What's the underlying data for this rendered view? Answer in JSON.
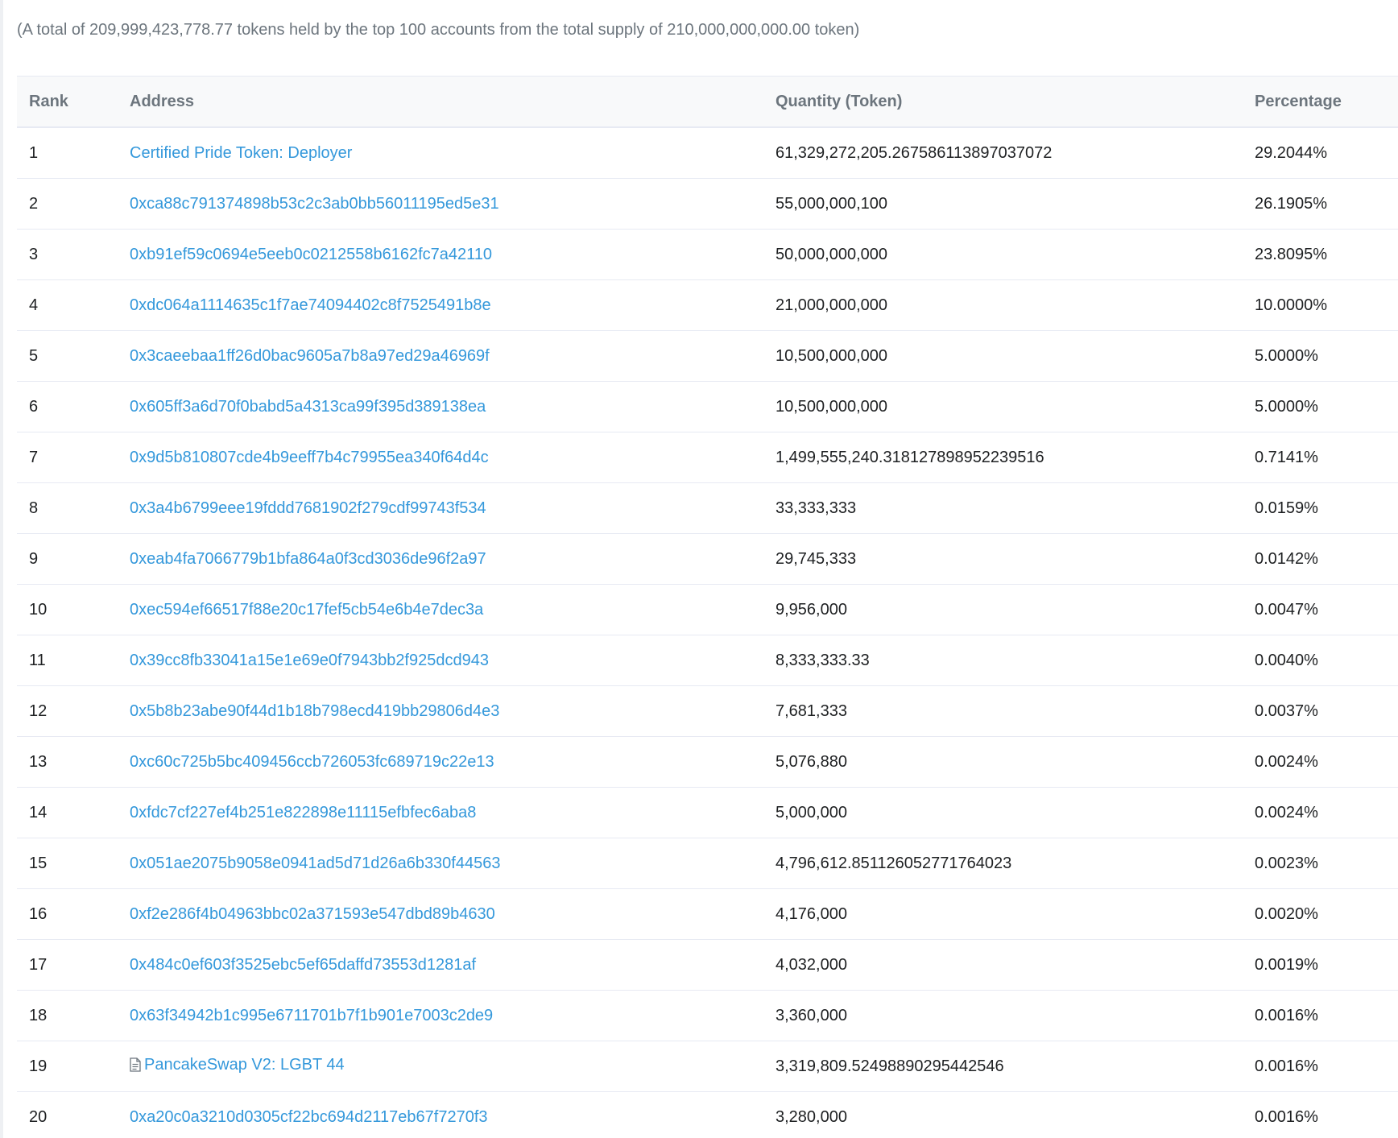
{
  "summary": "(A total of 209,999,423,778.77 tokens held by the top 100 accounts from the total supply of 210,000,000,000.00 token)",
  "table": {
    "headers": {
      "rank": "Rank",
      "address": "Address",
      "quantity": "Quantity (Token)",
      "percentage": "Percentage"
    },
    "rows": [
      {
        "rank": "1",
        "address": "Certified Pride Token: Deployer",
        "quantity": "61,329,272,205.267586113897037072",
        "percentage": "29.2044%",
        "icon": ""
      },
      {
        "rank": "2",
        "address": "0xca88c791374898b53c2c3ab0bb56011195ed5e31",
        "quantity": "55,000,000,100",
        "percentage": "26.1905%",
        "icon": ""
      },
      {
        "rank": "3",
        "address": "0xb91ef59c0694e5eeb0c0212558b6162fc7a42110",
        "quantity": "50,000,000,000",
        "percentage": "23.8095%",
        "icon": ""
      },
      {
        "rank": "4",
        "address": "0xdc064a1114635c1f7ae74094402c8f7525491b8e",
        "quantity": "21,000,000,000",
        "percentage": "10.0000%",
        "icon": ""
      },
      {
        "rank": "5",
        "address": "0x3caeebaa1ff26d0bac9605a7b8a97ed29a46969f",
        "quantity": "10,500,000,000",
        "percentage": "5.0000%",
        "icon": ""
      },
      {
        "rank": "6",
        "address": "0x605ff3a6d70f0babd5a4313ca99f395d389138ea",
        "quantity": "10,500,000,000",
        "percentage": "5.0000%",
        "icon": ""
      },
      {
        "rank": "7",
        "address": "0x9d5b810807cde4b9eeff7b4c79955ea340f64d4c",
        "quantity": "1,499,555,240.318127898952239516",
        "percentage": "0.7141%",
        "icon": ""
      },
      {
        "rank": "8",
        "address": "0x3a4b6799eee19fddd7681902f279cdf99743f534",
        "quantity": "33,333,333",
        "percentage": "0.0159%",
        "icon": ""
      },
      {
        "rank": "9",
        "address": "0xeab4fa7066779b1bfa864a0f3cd3036de96f2a97",
        "quantity": "29,745,333",
        "percentage": "0.0142%",
        "icon": ""
      },
      {
        "rank": "10",
        "address": "0xec594ef66517f88e20c17fef5cb54e6b4e7dec3a",
        "quantity": "9,956,000",
        "percentage": "0.0047%",
        "icon": ""
      },
      {
        "rank": "11",
        "address": "0x39cc8fb33041a15e1e69e0f7943bb2f925dcd943",
        "quantity": "8,333,333.33",
        "percentage": "0.0040%",
        "icon": ""
      },
      {
        "rank": "12",
        "address": "0x5b8b23abe90f44d1b18b798ecd419bb29806d4e3",
        "quantity": "7,681,333",
        "percentage": "0.0037%",
        "icon": ""
      },
      {
        "rank": "13",
        "address": "0xc60c725b5bc409456ccb726053fc689719c22e13",
        "quantity": "5,076,880",
        "percentage": "0.0024%",
        "icon": ""
      },
      {
        "rank": "14",
        "address": "0xfdc7cf227ef4b251e822898e11115efbfec6aba8",
        "quantity": "5,000,000",
        "percentage": "0.0024%",
        "icon": ""
      },
      {
        "rank": "15",
        "address": "0x051ae2075b9058e0941ad5d71d26a6b330f44563",
        "quantity": "4,796,612.851126052771764023",
        "percentage": "0.0023%",
        "icon": ""
      },
      {
        "rank": "16",
        "address": "0xf2e286f4b04963bbc02a371593e547dbd89b4630",
        "quantity": "4,176,000",
        "percentage": "0.0020%",
        "icon": ""
      },
      {
        "rank": "17",
        "address": "0x484c0ef603f3525ebc5ef65daffd73553d1281af",
        "quantity": "4,032,000",
        "percentage": "0.0019%",
        "icon": ""
      },
      {
        "rank": "18",
        "address": "0x63f34942b1c995e6711701b7f1b901e7003c2de9",
        "quantity": "3,360,000",
        "percentage": "0.0016%",
        "icon": ""
      },
      {
        "rank": "19",
        "address": "PancakeSwap V2: LGBT 44",
        "quantity": "3,319,809.52498890295442546",
        "percentage": "0.0016%",
        "icon": "contract-file-icon"
      },
      {
        "rank": "20",
        "address": "0xa20c0a3210d0305cf22bc694d2117eb67f7270f3",
        "quantity": "3,280,000",
        "percentage": "0.0016%",
        "icon": ""
      }
    ]
  },
  "colors": {
    "link": "#3498db",
    "muted_text": "#6c757d",
    "body_text": "#1e2022",
    "header_bg": "#f8f9fa",
    "border": "#e7eaf3"
  }
}
